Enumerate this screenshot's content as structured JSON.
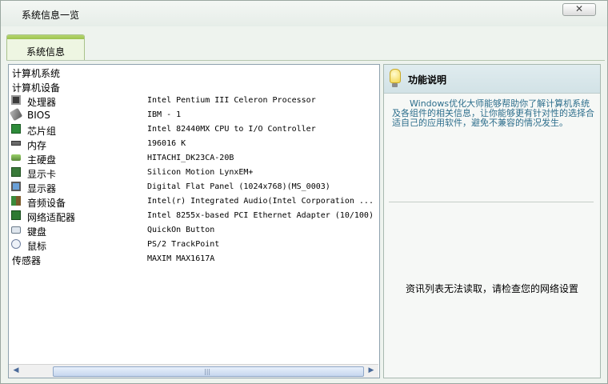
{
  "window": {
    "title": "系统信息一览",
    "close_icon": "close-icon"
  },
  "tab": {
    "label": "系统信息"
  },
  "system_info": {
    "rows": [
      {
        "name": "计算机系统",
        "value": "",
        "icon": ""
      },
      {
        "name": "计算机设备",
        "value": "",
        "icon": ""
      },
      {
        "name": "处理器",
        "value": "Intel Pentium III Celeron Processor",
        "icon": "cpu-icon"
      },
      {
        "name": "BIOS",
        "value": "IBM    - 1",
        "icon": "bios-icon"
      },
      {
        "name": "芯片组",
        "value": "Intel 82440MX CPU to I/O Controller",
        "icon": "chipset-icon"
      },
      {
        "name": "内存",
        "value": "196016 K",
        "icon": "memory-icon"
      },
      {
        "name": "主硬盘",
        "value": "HITACHI_DK23CA-20B",
        "icon": "hard-disk-icon"
      },
      {
        "name": "显示卡",
        "value": "Silicon Motion LynxEM+",
        "icon": "graphics-card-icon"
      },
      {
        "name": "显示器",
        "value": "Digital Flat Panel (1024x768)(MS_0003)",
        "icon": "monitor-icon"
      },
      {
        "name": "音频设备",
        "value": "Intel(r) Integrated Audio(Intel Corporation ...",
        "icon": "audio-device-icon"
      },
      {
        "name": "网络适配器",
        "value": "Intel 8255x-based PCI Ethernet Adapter (10/100)",
        "icon": "network-adapter-icon"
      },
      {
        "name": "键盘",
        "value": "QuickOn Button",
        "icon": "keyboard-icon"
      },
      {
        "name": "鼠标",
        "value": "PS/2 TrackPoint",
        "icon": "mouse-icon"
      },
      {
        "name": "传感器",
        "value": "MAXIM MAX1617A",
        "icon": ""
      }
    ],
    "scroll_left_icon": "scroll-left-arrow-icon",
    "scroll_right_icon": "scroll-right-arrow-icon"
  },
  "function_panel": {
    "icon": "lightbulb-icon",
    "title": "功能说明",
    "description": "Windows优化大师能够帮助你了解计算机系统及各组件的相关信息，让你能够更有针对性的选择合适自己的应用软件，避免不兼容的情况发生。",
    "notice": "资讯列表无法读取，请检查您的网络设置"
  }
}
